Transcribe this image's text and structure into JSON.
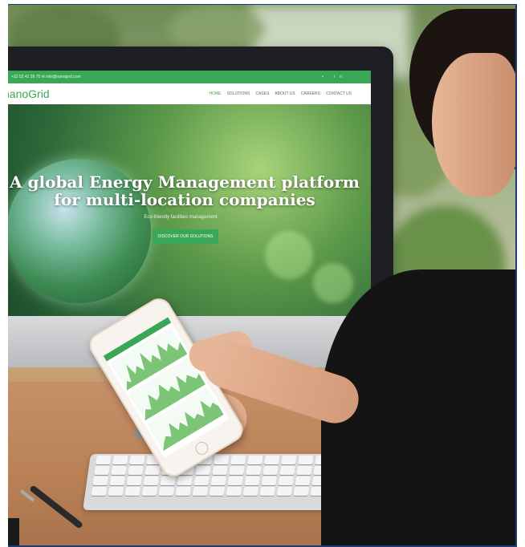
{
  "screen": {
    "topbar": {
      "contact": "+32 52 41 39 75  ✉ info@nanogrid.com",
      "social": "• in"
    },
    "logo": "nanoGrid",
    "nav": [
      "HOME",
      "SOLUTIONS",
      "CASES",
      "ABOUT US",
      "CAREERS",
      "CONTACT US"
    ],
    "hero": {
      "title_line1": "A global Energy Management platform",
      "title_line2": "for multi-location companies",
      "subtitle": "Eco-friendly facilities management",
      "button": "DISCOVER OUR SOLUTIONS"
    }
  },
  "colors": {
    "brand_green": "#3aa757"
  }
}
